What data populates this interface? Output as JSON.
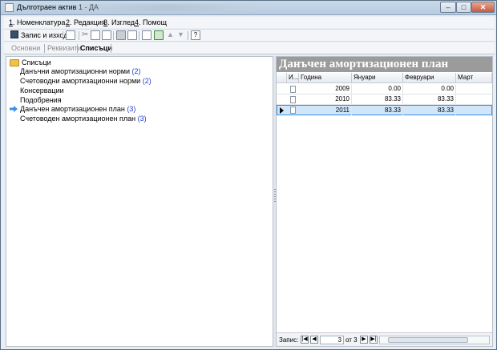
{
  "window": {
    "title": "Дълготраен актив 1 - ДА",
    "min": "–",
    "max": "□",
    "close": "✕"
  },
  "menu": [
    {
      "num": "1",
      "label": ". Номенклатура"
    },
    {
      "num": "2",
      "label": ". Редакция"
    },
    {
      "num": "3",
      "label": ". Изглед"
    },
    {
      "num": "4",
      "label": ". Помощ"
    }
  ],
  "toolbar": {
    "save_label": "Запис и изход",
    "icons": [
      "save-icon",
      "copy-record-icon",
      "cut-icon",
      "copy-icon",
      "paste-icon",
      "print-icon",
      "print-preview-icon",
      "list-icon",
      "refresh-icon",
      "up-icon",
      "down-icon",
      "help-icon"
    ]
  },
  "tabs": [
    "Основни",
    "Реквизити",
    "Списъци"
  ],
  "tree": {
    "root": "Списъци",
    "items": [
      {
        "label": "Данъчни амортизационни норми",
        "count": "(2)"
      },
      {
        "label": "Счетоводни амортизационни норми",
        "count": "(2)"
      },
      {
        "label": "Консервации",
        "count": ""
      },
      {
        "label": "Подобрения",
        "count": ""
      },
      {
        "label": "Данъчен амортизационен план",
        "count": "(3)"
      },
      {
        "label": "Счетоводен амортизационен план",
        "count": "(3)"
      }
    ]
  },
  "plan": {
    "title": "Данъчен амортизационен план",
    "columns": [
      "И...",
      "Година",
      "Януари",
      "Февруари",
      "Март"
    ],
    "rows": [
      {
        "year": "2009",
        "jan": "0.00",
        "feb": "0.00"
      },
      {
        "year": "2010",
        "jan": "83.33",
        "feb": "83.33"
      },
      {
        "year": "2011",
        "jan": "83.33",
        "feb": "83.33"
      }
    ]
  },
  "nav": {
    "label": "Запис:",
    "current": "3",
    "of": "от 3"
  }
}
